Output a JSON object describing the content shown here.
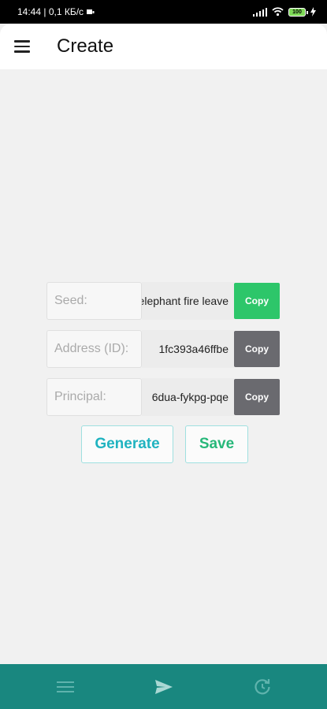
{
  "status_bar": {
    "time_network": "14:44 | 0,1 КБ/с",
    "battery": "100"
  },
  "app_bar": {
    "title": "Create"
  },
  "form": {
    "seed": {
      "label": "Seed:",
      "value": "elephant fire leave",
      "copy_label": "Copy"
    },
    "address": {
      "label": "Address (ID):",
      "value": "1fc393a46ffbe",
      "copy_label": "Copy"
    },
    "principal": {
      "label": "Principal:",
      "value": "6dua-fykpg-pqe",
      "copy_label": "Copy"
    }
  },
  "actions": {
    "generate_label": "Generate",
    "save_label": "Save"
  },
  "bottom_nav": {
    "items": [
      "menu-icon",
      "send-icon",
      "history-icon"
    ]
  },
  "colors": {
    "primary_teal": "#19877f",
    "copy_active": "#2dc66a",
    "copy_inactive": "#6a6a6f",
    "generate_text": "#20b3c0",
    "save_text": "#27b87a"
  }
}
